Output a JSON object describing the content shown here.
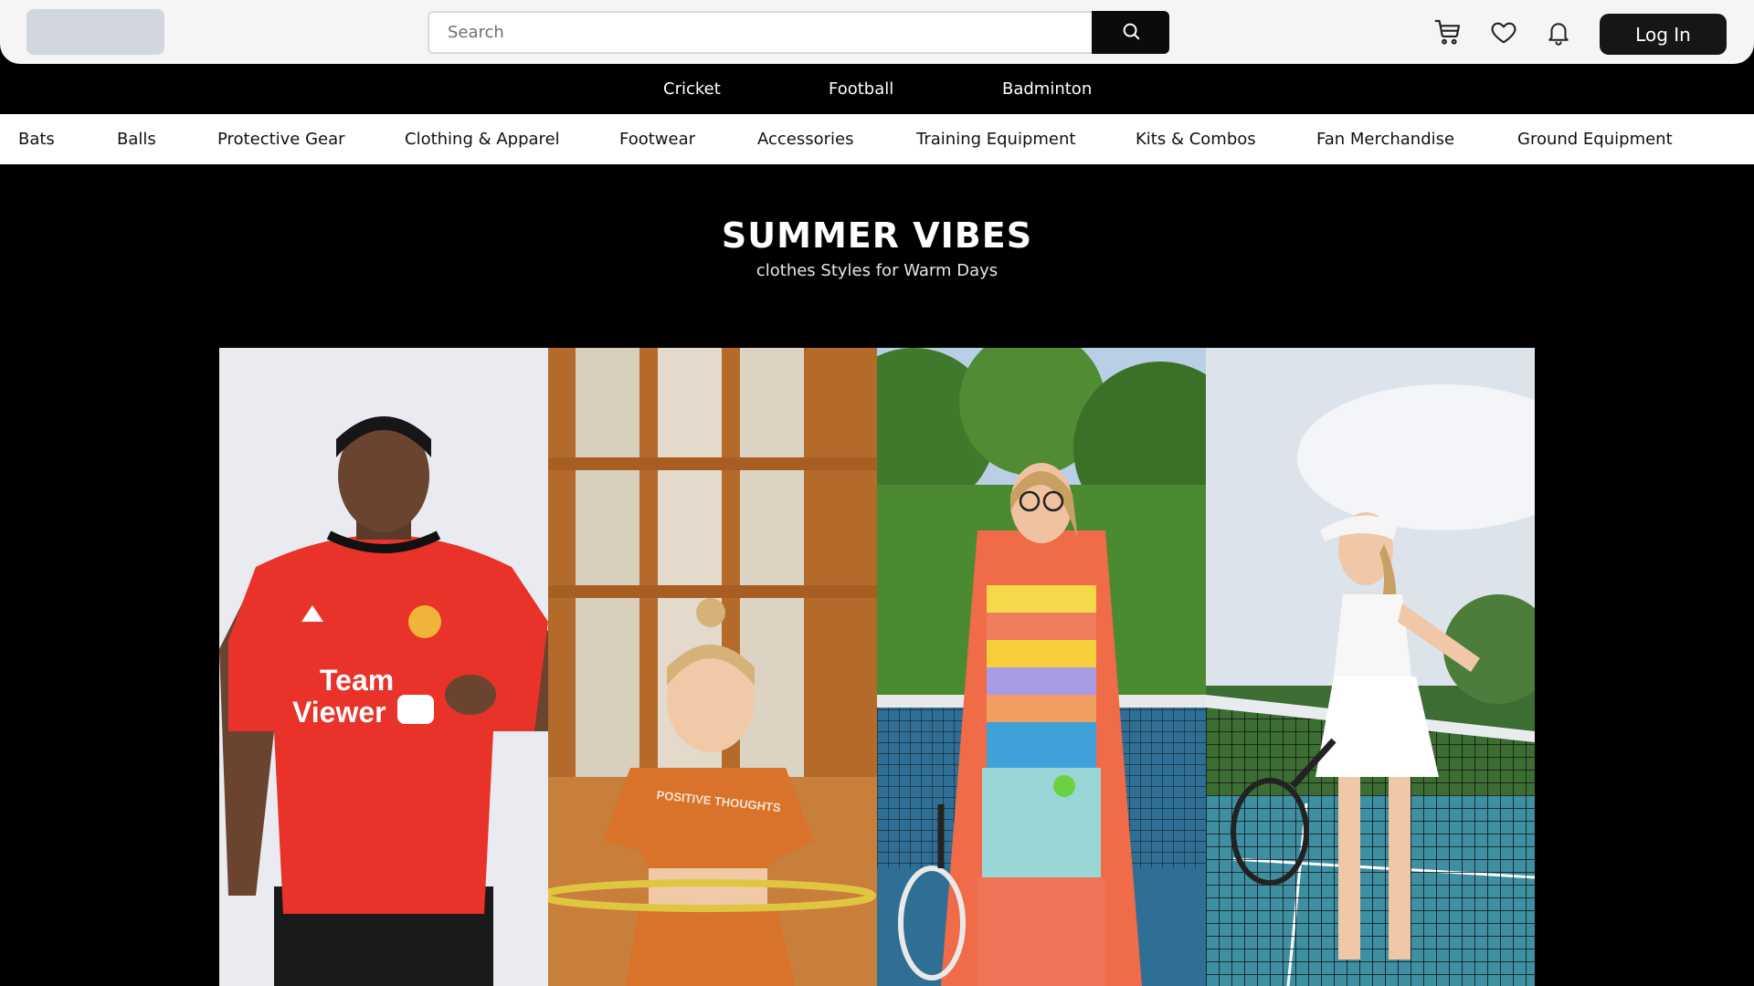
{
  "header": {
    "search": {
      "placeholder": "Search",
      "value": ""
    },
    "icons": [
      "cart-icon",
      "heart-icon",
      "bell-icon",
      "search-icon"
    ],
    "login_label": "Log In"
  },
  "sport_nav": [
    "Cricket",
    "Football",
    "Badminton"
  ],
  "category_nav": [
    "Bats",
    "Balls",
    "Protective Gear",
    "Clothing & Apparel",
    "Footwear",
    "Accessories",
    "Training Equipment",
    "Kits & Combos",
    "Fan Merchandise",
    "Ground Equipment"
  ],
  "hero": {
    "title": "SUMMER VIBES",
    "subtitle": "clothes Styles for Warm Days"
  },
  "gallery": {
    "photos": [
      {
        "description": "man in red football jersey",
        "jersey_text": "Team Viewer"
      },
      {
        "description": "girl with hula hoop in gym",
        "shirt_text": "POSITIVE THOUGHTS"
      },
      {
        "description": "woman in rainbow striped dress with tennis racket"
      },
      {
        "description": "woman in white tennis outfit leaning on net"
      }
    ]
  },
  "colors": {
    "header_bg": "#f5f5f6",
    "nav_bg": "#000000",
    "category_bg": "#ffffff",
    "button_dark": "#161616",
    "logo_placeholder": "#d2d6de"
  }
}
